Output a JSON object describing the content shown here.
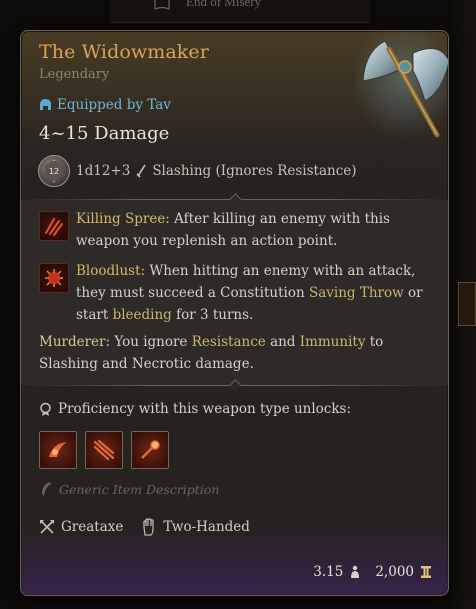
{
  "background": {
    "top_item_text": "End of Misery"
  },
  "tooltip": {
    "name": "The Widowmaker",
    "rarity": "Legendary",
    "equipped_label": "Equipped by Tav",
    "damage": "4~15 Damage",
    "dice_badge": "12",
    "damage_formula": "1d12+3",
    "damage_type": "Slashing (Ignores Resistance)",
    "passives": [
      {
        "name": "Killing Spree:",
        "icon": "killing-spree-icon",
        "text": "After killing an enemy with this weapon you replenish an action point."
      },
      {
        "name": "Bloodlust:",
        "icon": "bloodlust-icon",
        "text_a": "When hitting an enemy with an attack, they must succeed a Constitution",
        "link_a": "Saving Throw",
        "text_b": "or start",
        "link_b": "bleeding",
        "text_c": "for 3 turns."
      }
    ],
    "murderer": {
      "name": "Murderer:",
      "text_a": "You ignore",
      "link_a": "Resistance",
      "text_b": "and",
      "link_b": "Immunity",
      "text_c": "to Slashing and Necrotic damage."
    },
    "proficiency_title": "Proficiency with this weapon type unlocks:",
    "proficiency_actions": [
      "cleave-icon",
      "lacerate-icon",
      "pommel-strike-icon"
    ],
    "generic_description": "Generic Item Description",
    "tags": [
      "Greataxe",
      "Two-Handed"
    ],
    "weight": "3.15",
    "value": "2,000",
    "colors": {
      "name": "#dba35a",
      "equipped": "#6fb7d9",
      "keyword": "#d9b865",
      "rarity_glow": "#6a3a9a"
    }
  }
}
